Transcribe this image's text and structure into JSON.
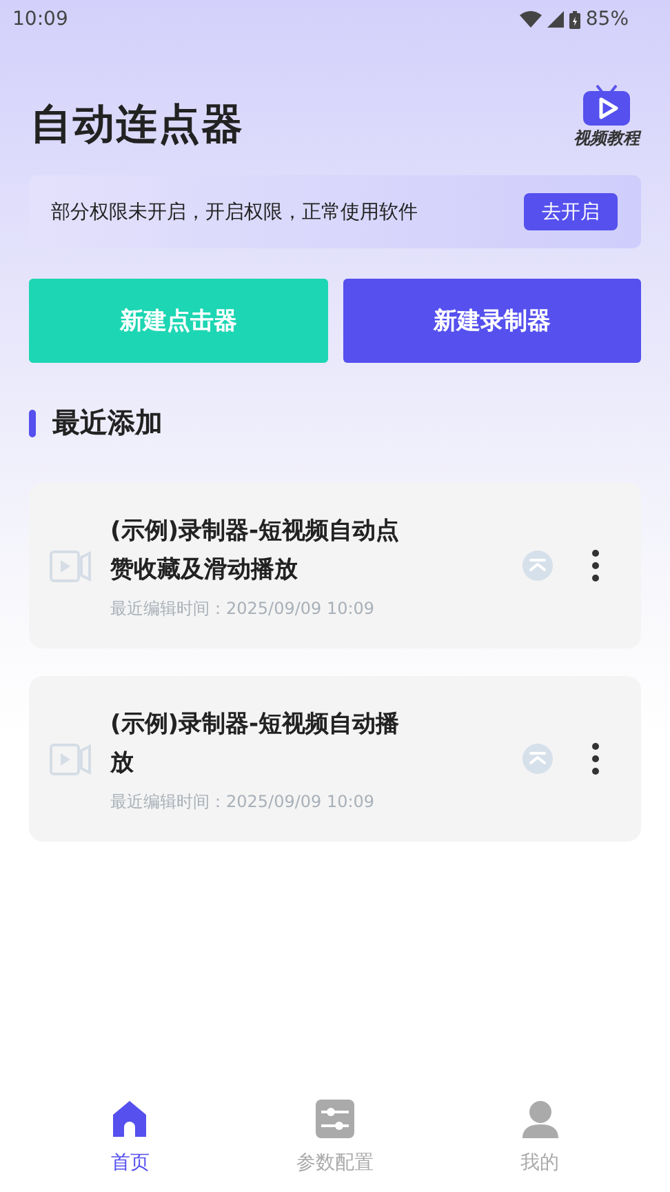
{
  "status_bar": {
    "time": "10:09",
    "battery": "85%"
  },
  "header": {
    "title": "自动连点器",
    "tutorial_label": "视频教程"
  },
  "notice": {
    "text": "部分权限未开启，开启权限，正常使用软件",
    "button": "去开启"
  },
  "actions": [
    {
      "label": "新建点击器",
      "kind": "clicker"
    },
    {
      "label": "新建录制器",
      "kind": "recorder"
    }
  ],
  "section_title": "最近添加",
  "items": [
    {
      "title": "(示例)录制器-短视频自动点赞收藏及滑动播放",
      "edited": "最近编辑时间：2025/09/09 10:09"
    },
    {
      "title": "(示例)录制器-短视频自动播放",
      "edited": "最近编辑时间：2025/09/09 10:09"
    }
  ],
  "nav": [
    {
      "label": "首页",
      "kind": "home",
      "selected": true
    },
    {
      "label": "参数配置",
      "kind": "sliders",
      "selected": false
    },
    {
      "label": "我的",
      "kind": "person",
      "selected": false
    }
  ]
}
